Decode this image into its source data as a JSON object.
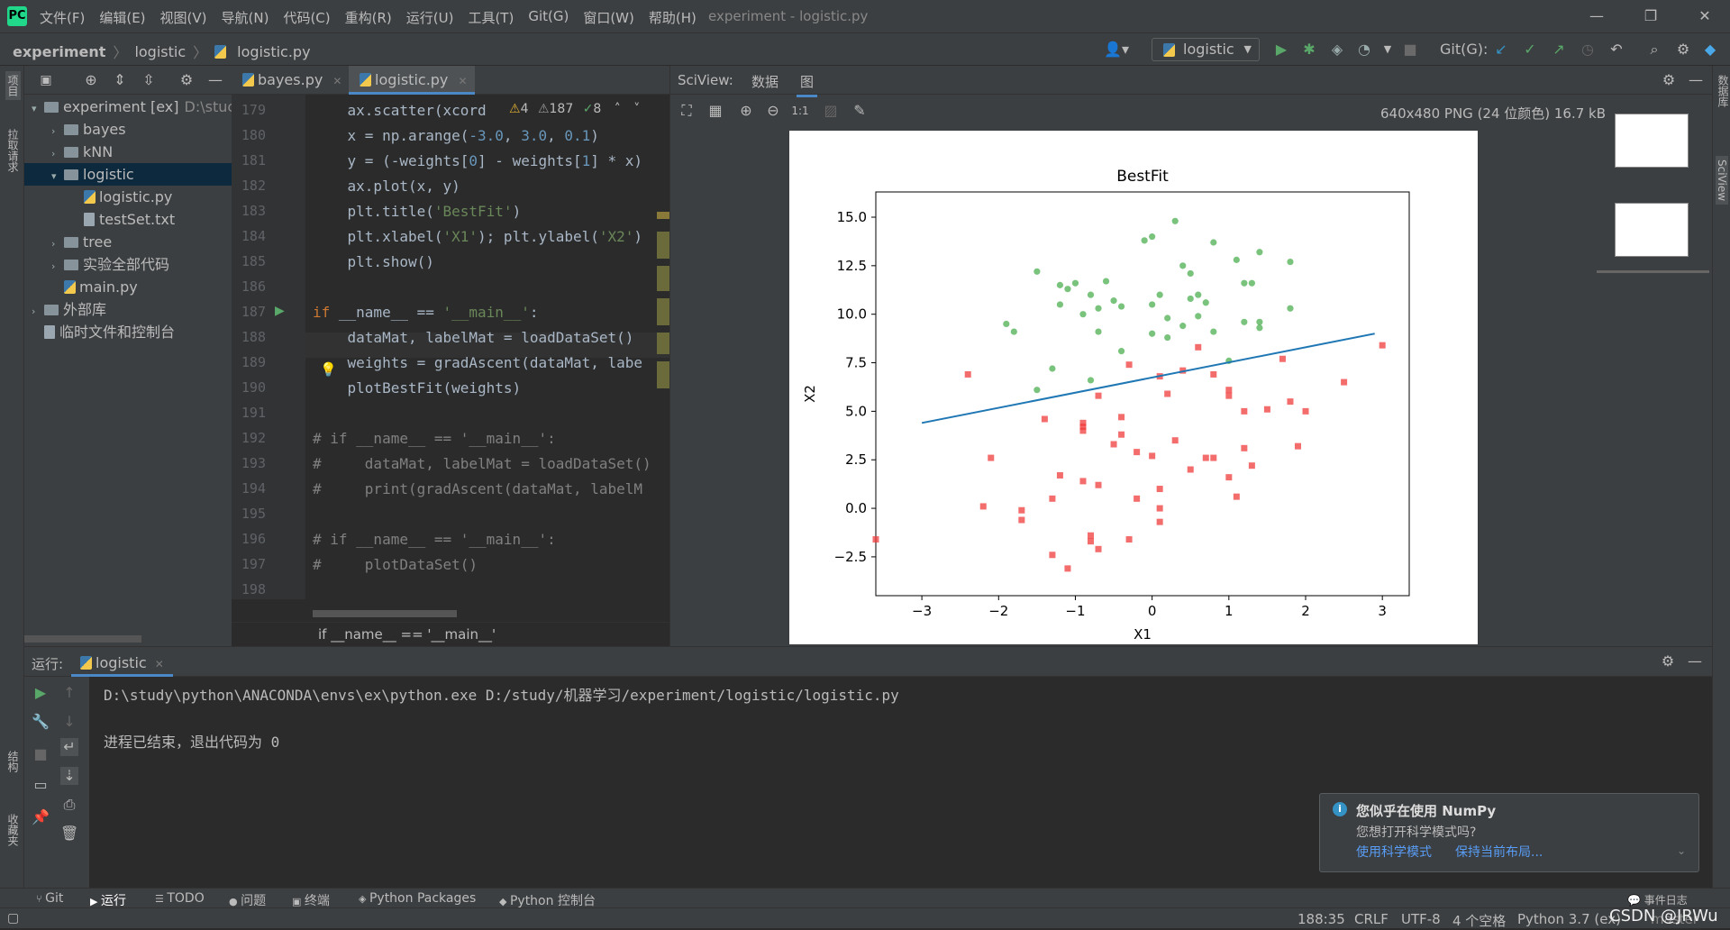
{
  "window": {
    "menus": [
      "文件(F)",
      "编辑(E)",
      "视图(V)",
      "导航(N)",
      "代码(C)",
      "重构(R)",
      "运行(U)",
      "工具(T)",
      "Git(G)",
      "窗口(W)",
      "帮助(H)"
    ],
    "title": "experiment - logistic.py"
  },
  "nav": {
    "crumb1": "experiment",
    "crumb2": "logistic",
    "crumb3": "logistic.py",
    "run_config": "logistic",
    "git_label": "Git(G):"
  },
  "left_strip": {
    "project": "项目",
    "pull_requests": "拉取请求",
    "structure": "结构",
    "favorites": "收藏夹"
  },
  "project_tree": [
    {
      "label": "experiment [ex]",
      "extra": "D:\\stuc",
      "indent": 0,
      "kind": "folder",
      "arrow": "▾"
    },
    {
      "label": "bayes",
      "indent": 1,
      "kind": "folder",
      "arrow": "›"
    },
    {
      "label": "kNN",
      "indent": 1,
      "kind": "folder",
      "arrow": "›"
    },
    {
      "label": "logistic",
      "indent": 1,
      "kind": "folder",
      "arrow": "▾",
      "selected": true
    },
    {
      "label": "logistic.py",
      "indent": 2,
      "kind": "py"
    },
    {
      "label": "testSet.txt",
      "indent": 2,
      "kind": "txt"
    },
    {
      "label": "tree",
      "indent": 1,
      "kind": "folder",
      "arrow": "›"
    },
    {
      "label": "实验全部代码",
      "indent": 1,
      "kind": "folder",
      "arrow": "›"
    },
    {
      "label": "main.py",
      "indent": 1,
      "kind": "py"
    },
    {
      "label": "外部库",
      "indent": 0,
      "kind": "lib",
      "arrow": "›"
    },
    {
      "label": "临时文件和控制台",
      "indent": 0,
      "kind": "scratch"
    }
  ],
  "editor": {
    "tabs": [
      "bayes.py",
      "logistic.py"
    ],
    "inspections": {
      "warnings": "4",
      "weak": "187",
      "ok": "8"
    },
    "breadcrumb": "if __name__ == '__main__'",
    "lines": [
      {
        "n": "179",
        "html": "    ax.scatter(xcord"
      },
      {
        "n": "180",
        "html": "    x = np.arange(<span class=\"num\">-3.0</span>, <span class=\"num\">3.0</span>, <span class=\"num\">0.1</span>)"
      },
      {
        "n": "181",
        "html": "    y = (-weights[<span class=\"num\">0</span>] - weights[<span class=\"num\">1</span>] * x)"
      },
      {
        "n": "182",
        "html": "    ax.plot(x, y)"
      },
      {
        "n": "183",
        "html": "    plt.title(<span class=\"str\">'BestFit'</span>)"
      },
      {
        "n": "184",
        "html": "    plt.xlabel(<span class=\"str\">'X1'</span>); plt.ylabel(<span class=\"str\">'X2'</span>)"
      },
      {
        "n": "185",
        "html": "    plt.show()"
      },
      {
        "n": "186",
        "html": ""
      },
      {
        "n": "187",
        "html": "<span class=\"kw\">if</span> __name__ == <span class=\"str\">'__main__'</span>:"
      },
      {
        "n": "188",
        "html": "    dataMat, labelMat = loadDataSet()"
      },
      {
        "n": "189",
        "html": "    weights = gradAscent(dataMat, labe"
      },
      {
        "n": "190",
        "html": "    plotBestFit(weights)"
      },
      {
        "n": "191",
        "html": ""
      },
      {
        "n": "192",
        "html": "<span class=\"cm\"># if __name__ == '__main__':</span>"
      },
      {
        "n": "193",
        "html": "<span class=\"cm\">#     dataMat, labelMat = loadDataSet()</span>"
      },
      {
        "n": "194",
        "html": "<span class=\"cm\">#     print(gradAscent(dataMat, labelM</span>"
      },
      {
        "n": "195",
        "html": ""
      },
      {
        "n": "196",
        "html": "<span class=\"cm\"># if __name__ == '__main__':</span>"
      },
      {
        "n": "197",
        "html": "<span class=\"cm\">#     plotDataSet()</span>"
      },
      {
        "n": "198",
        "html": ""
      }
    ]
  },
  "sciview": {
    "label": "SciView:",
    "tab_data": "数据",
    "tab_plot": "图",
    "image_info": "640x480 PNG (24 位颜色) 16.7 kB",
    "right_label_1": "数据库",
    "right_label_2": "SciView"
  },
  "chart_data": {
    "type": "scatter",
    "title": "BestFit",
    "xlabel": "X1",
    "ylabel": "X2",
    "xlim": [
      -3.6,
      3.35
    ],
    "ylim": [
      -4.5,
      16.3
    ],
    "xticks": [
      "−3",
      "−2",
      "−1",
      "0",
      "1",
      "2",
      "3"
    ],
    "xtick_values": [
      -3,
      -2,
      -1,
      0,
      1,
      2,
      3
    ],
    "yticks": [
      "−2.5",
      "0.0",
      "2.5",
      "5.0",
      "7.5",
      "10.0",
      "12.5",
      "15.0"
    ],
    "ytick_values": [
      -2.5,
      0,
      2.5,
      5,
      7.5,
      10,
      12.5,
      15
    ],
    "colors": {
      "class1": "#4caf50",
      "class0": "#f03c3c",
      "line": "#1f77b4"
    },
    "line": {
      "x": [
        -3.0,
        2.9
      ],
      "y": [
        4.4,
        9.0
      ]
    },
    "class1_points": [
      [
        0.3,
        14.8
      ],
      [
        -0.1,
        13.8
      ],
      [
        0.0,
        14.0
      ],
      [
        0.8,
        13.7
      ],
      [
        1.4,
        13.2
      ],
      [
        0.4,
        12.5
      ],
      [
        -1.5,
        12.2
      ],
      [
        0.5,
        12.1
      ],
      [
        1.1,
        12.8
      ],
      [
        1.8,
        12.7
      ],
      [
        -1.0,
        11.6
      ],
      [
        -1.2,
        11.5
      ],
      [
        -0.6,
        11.7
      ],
      [
        1.2,
        11.6
      ],
      [
        1.3,
        11.6
      ],
      [
        -1.1,
        11.3
      ],
      [
        -0.8,
        11.0
      ],
      [
        0.1,
        11.0
      ],
      [
        0.6,
        11.0
      ],
      [
        -1.2,
        10.5
      ],
      [
        -0.5,
        10.7
      ],
      [
        -0.7,
        10.3
      ],
      [
        -0.4,
        10.4
      ],
      [
        0.0,
        10.5
      ],
      [
        0.5,
        10.8
      ],
      [
        0.7,
        10.6
      ],
      [
        1.8,
        10.3
      ],
      [
        -0.9,
        10.0
      ],
      [
        0.2,
        9.8
      ],
      [
        0.6,
        9.9
      ],
      [
        0.4,
        9.4
      ],
      [
        1.2,
        9.6
      ],
      [
        1.4,
        9.6
      ],
      [
        -1.9,
        9.5
      ],
      [
        -1.8,
        9.1
      ],
      [
        -0.7,
        9.1
      ],
      [
        0.0,
        9.0
      ],
      [
        0.8,
        9.1
      ],
      [
        -0.4,
        8.1
      ],
      [
        1.4,
        9.3
      ],
      [
        0.2,
        8.8
      ],
      [
        -1.3,
        7.2
      ],
      [
        -0.8,
        6.6
      ],
      [
        -1.5,
        6.1
      ],
      [
        1.0,
        7.6
      ]
    ],
    "class0_points": [
      [
        -2.4,
        6.9
      ],
      [
        0.6,
        8.3
      ],
      [
        -0.3,
        7.4
      ],
      [
        0.4,
        7.1
      ],
      [
        0.1,
        6.8
      ],
      [
        1.7,
        7.7
      ],
      [
        2.5,
        6.5
      ],
      [
        3.0,
        8.4
      ],
      [
        -1.4,
        4.6
      ],
      [
        -0.7,
        5.8
      ],
      [
        0.2,
        5.9
      ],
      [
        0.8,
        6.9
      ],
      [
        1.0,
        5.8
      ],
      [
        1.0,
        6.1
      ],
      [
        1.2,
        5.0
      ],
      [
        1.5,
        5.1
      ],
      [
        1.8,
        5.5
      ],
      [
        2.0,
        5.0
      ],
      [
        -0.9,
        4.2
      ],
      [
        -0.9,
        4.4
      ],
      [
        -0.9,
        4.0
      ],
      [
        -0.4,
        4.7
      ],
      [
        -0.4,
        3.8
      ],
      [
        -0.5,
        3.3
      ],
      [
        0.3,
        3.5
      ],
      [
        -0.2,
        2.9
      ],
      [
        0.0,
        2.7
      ],
      [
        0.7,
        2.6
      ],
      [
        0.8,
        2.6
      ],
      [
        1.2,
        3.1
      ],
      [
        1.3,
        2.2
      ],
      [
        1.9,
        3.2
      ],
      [
        -2.1,
        2.6
      ],
      [
        -1.2,
        1.7
      ],
      [
        -0.9,
        1.4
      ],
      [
        -0.7,
        1.2
      ],
      [
        0.1,
        1.0
      ],
      [
        0.5,
        2.0
      ],
      [
        1.0,
        1.6
      ],
      [
        -2.2,
        0.1
      ],
      [
        -1.3,
        0.5
      ],
      [
        -0.2,
        0.5
      ],
      [
        0.1,
        0.0
      ],
      [
        0.1,
        -0.7
      ],
      [
        1.1,
        0.6
      ],
      [
        -1.7,
        -0.1
      ],
      [
        -1.7,
        -0.6
      ],
      [
        -0.8,
        -1.4
      ],
      [
        -0.8,
        -1.7
      ],
      [
        -0.3,
        -1.6
      ],
      [
        -0.7,
        -2.1
      ],
      [
        -1.3,
        -2.4
      ],
      [
        -1.1,
        -3.1
      ],
      [
        -3.6,
        -1.6
      ]
    ]
  },
  "run": {
    "label": "运行:",
    "tab": "logistic",
    "cmd": "D:\\study\\python\\ANACONDA\\envs\\ex\\python.exe D:/study/机器学习/experiment/logistic/logistic.py",
    "exit": "进程已结束，退出代码为 0"
  },
  "notification": {
    "title": "您似乎在使用 NumPy",
    "body": "您想打开科学模式吗?",
    "action1": "使用科学模式",
    "action2": "保持当前布局..."
  },
  "bottom_tabs": [
    "Git",
    "运行",
    "TODO",
    "问题",
    "终端",
    "Python Packages",
    "Python 控制台"
  ],
  "event_log": "事件日志",
  "status": {
    "pos": "188:35",
    "crlf": "CRLF",
    "enc": "UTF-8",
    "indent": "4 个空格",
    "interp": "Python 3.7 (ex)",
    "branch": "master",
    "watermark": "CSDN @JRWu"
  }
}
